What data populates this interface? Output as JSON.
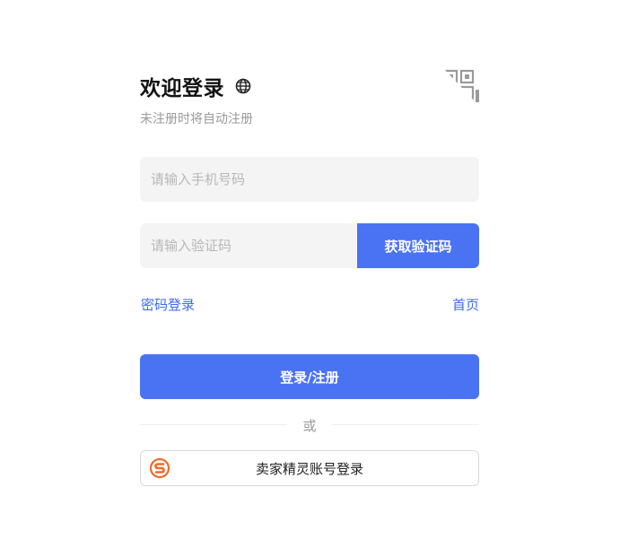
{
  "header": {
    "title": "欢迎登录",
    "subtitle": "未注册时将自动注册"
  },
  "form": {
    "phone_placeholder": "请输入手机号码",
    "code_placeholder": "请输入验证码",
    "get_code_label": "获取验证码",
    "password_login_label": "密码登录",
    "home_label": "首页",
    "submit_label": "登录/注册",
    "divider_label": "或",
    "seller_login_label": "卖家精灵账号登录"
  },
  "colors": {
    "primary": "#4a73f4",
    "link": "#3d6af0",
    "input_bg": "#f4f4f4",
    "seller_logo": "#f26b2c"
  },
  "icons": {
    "language": "globe-icon",
    "qr": "qr-code-icon",
    "seller": "seller-sprite-logo-icon"
  }
}
